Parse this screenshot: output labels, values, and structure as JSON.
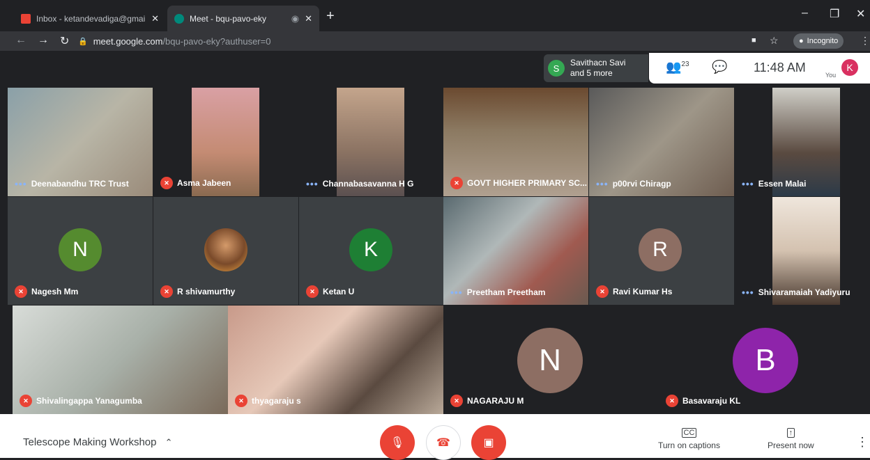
{
  "browser": {
    "tabs": [
      {
        "title": "Inbox - ketandevadiga@gmail.com",
        "close": "✕"
      },
      {
        "title": "Meet - bqu-pavo-eky",
        "close": "✕",
        "recording": "◉"
      }
    ],
    "new_tab": "+",
    "url_host": "meet.google.com",
    "url_path": "/bqu-pavo-eky?authuser=0",
    "incognito_label": "Incognito",
    "window_controls": {
      "minimize": "–",
      "restore": "❐",
      "close": "✕"
    }
  },
  "meet": {
    "notification": {
      "initial": "S",
      "line1": "Savithacn Savi",
      "line2": "and 5 more"
    },
    "people_count": "23",
    "time": "11:48 AM",
    "you_label": "You",
    "you_initial": "K",
    "participants": [
      {
        "name": "Deenabandhu TRC Trust",
        "status": "dots"
      },
      {
        "name": "Asma Jabeen",
        "status": "muted"
      },
      {
        "name": "Channabasavanna H G",
        "status": "dots"
      },
      {
        "name": "GOVT HIGHER PRIMARY SC...",
        "status": "muted"
      },
      {
        "name": "p00rvi Chiragp",
        "status": "dots"
      },
      {
        "name": "Essen Malai",
        "status": "dots"
      },
      {
        "name": "Nagesh Mm",
        "status": "muted",
        "initial": "N"
      },
      {
        "name": "R shivamurthy",
        "status": "muted"
      },
      {
        "name": "Ketan U",
        "status": "muted",
        "initial": "K"
      },
      {
        "name": "Preetham Preetham",
        "status": "dots"
      },
      {
        "name": "Ravi Kumar Hs",
        "status": "muted",
        "initial": "R"
      },
      {
        "name": "Shivaramaiah Yadiyuru",
        "status": "dots"
      },
      {
        "name": "Shivalingappa Yanagumba",
        "status": "muted"
      },
      {
        "name": "thyagaraju s",
        "status": "muted"
      },
      {
        "name": "NAGARAJU M",
        "status": "muted",
        "initial": "N"
      },
      {
        "name": "Basavaraju KL",
        "status": "muted",
        "initial": "B"
      }
    ],
    "meeting_title": "Telescope Making Workshop",
    "captions_label": "Turn on captions",
    "present_label": "Present now"
  },
  "colors": {
    "avatar_green": "#558b2f",
    "avatar_dark_green": "#1e7f34",
    "avatar_brown": "#8d6e63",
    "avatar_purple": "#8e24aa",
    "danger": "#ea4335"
  }
}
